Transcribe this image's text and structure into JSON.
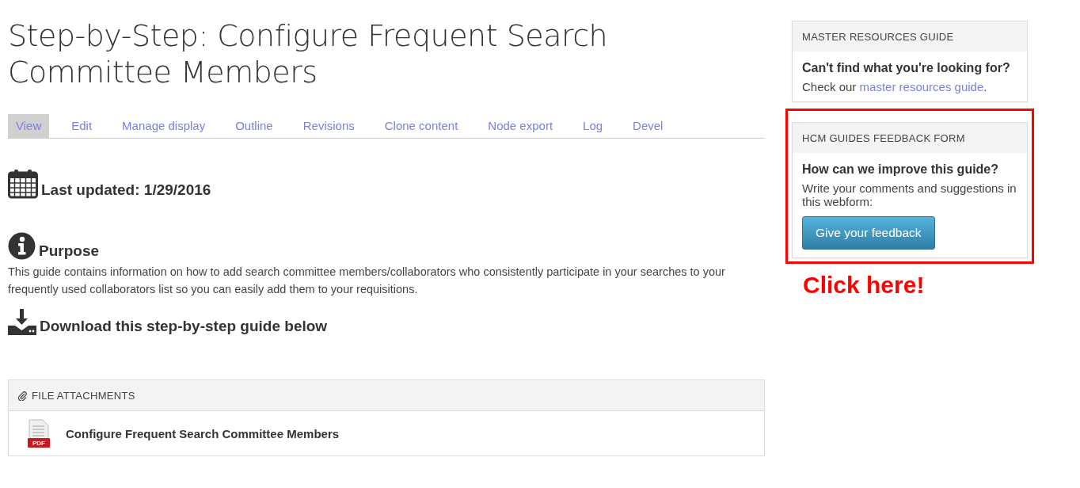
{
  "title": "Step-by-Step: Configure Frequent Search Committee Members",
  "tabs": [
    {
      "label": "View",
      "selected": true
    },
    {
      "label": "Edit",
      "selected": false
    },
    {
      "label": "Manage display",
      "selected": false
    },
    {
      "label": "Outline",
      "selected": false
    },
    {
      "label": "Revisions",
      "selected": false
    },
    {
      "label": "Clone content",
      "selected": false
    },
    {
      "label": "Node export",
      "selected": false
    },
    {
      "label": "Log",
      "selected": false
    },
    {
      "label": "Devel",
      "selected": false
    }
  ],
  "sections": [
    {
      "kind": "updated",
      "heading": "Last updated: 1/29/2016"
    },
    {
      "kind": "purpose",
      "heading": "Purpose",
      "body": "This guide contains information on how to add search committee members/collaborators who consistently participate in your searches to your frequently used collaborators list so you can easily add them to your requisitions."
    },
    {
      "kind": "download",
      "heading": "Download this step-by-step guide below"
    }
  ],
  "attachments": {
    "title": "FILE ATTACHMENTS",
    "files": [
      {
        "name": "Configure Frequent Search Committee Members",
        "type": "PDF"
      }
    ]
  },
  "sidebar": [
    {
      "title": "MASTER RESOURCES GUIDE",
      "question": "Can't find what you're looking for?",
      "text": "Check our ",
      "link": "master resources guide",
      "after": ".",
      "highlighted": false
    },
    {
      "title": "HCM GUIDES FEEDBACK FORM",
      "question": "How can we improve this guide?",
      "text": "Write your comments and suggestions in this webform:",
      "button": "Give your feedback",
      "highlighted": true
    }
  ],
  "annotation": "Click here!"
}
